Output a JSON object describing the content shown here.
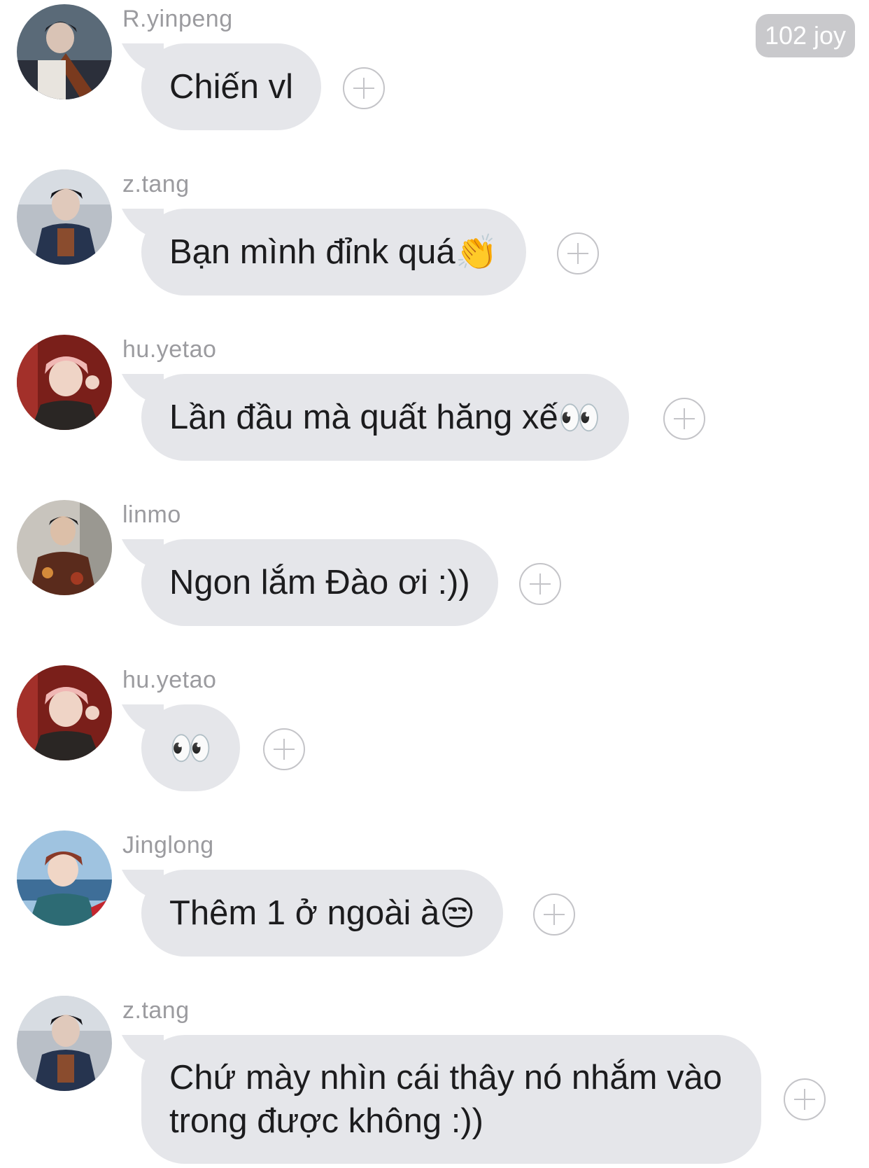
{
  "header": {
    "badge_label": "102 joy"
  },
  "messages": [
    {
      "sender": "R.yinpeng",
      "text": "Chiến vl",
      "emoji": "",
      "avatar_icon": "avatar-r-yinpeng"
    },
    {
      "sender": "z.tang",
      "text": "Bạn mình đỉnk quá",
      "emoji": "👏",
      "avatar_icon": "avatar-z-tang"
    },
    {
      "sender": "hu.yetao",
      "text": "Lần đầu mà quất hăng xế",
      "emoji": "👀",
      "avatar_icon": "avatar-hu-yetao"
    },
    {
      "sender": "linmo",
      "text": "Ngon lắm Đào ơi :))",
      "emoji": "",
      "avatar_icon": "avatar-linmo"
    },
    {
      "sender": "hu.yetao",
      "text": "",
      "emoji": "👀",
      "avatar_icon": "avatar-hu-yetao"
    },
    {
      "sender": "Jinglong",
      "text": "Thêm 1 ở ngoài à",
      "emoji": "😒",
      "avatar_icon": "avatar-jinglong"
    },
    {
      "sender": "z.tang",
      "text": "Chứ mày nhìn cái thây nó nhắm vào trong được không :))",
      "emoji": "",
      "avatar_icon": "avatar-z-tang"
    }
  ],
  "colors": {
    "bubble": "#e5e6ea",
    "sender_text": "#9b9b9f",
    "badge_bg": "#c9c9cc"
  }
}
